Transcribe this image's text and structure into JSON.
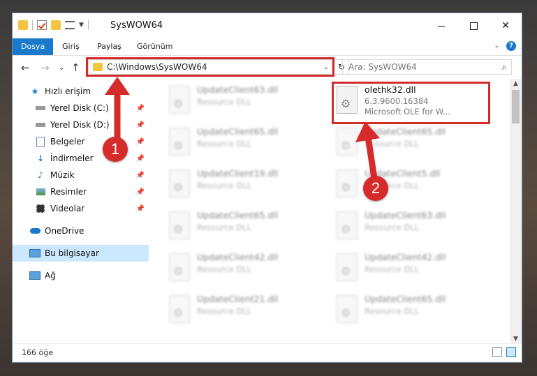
{
  "window": {
    "title": "SysWOW64"
  },
  "ribbon": {
    "tabs": [
      "Dosya",
      "Giriş",
      "Paylaş",
      "Görünüm"
    ],
    "help": "?"
  },
  "navbar": {
    "address": "C:\\Windows\\SysWOW64",
    "search_placeholder": "Ara: SysWOW64"
  },
  "sidebar": {
    "items": [
      {
        "label": "Hızlı erişim",
        "icon": "star-icon"
      },
      {
        "label": "Yerel Disk (C:)",
        "icon": "drive-icon"
      },
      {
        "label": "Yerel Disk (D:)",
        "icon": "drive-icon"
      },
      {
        "label": "Belgeler",
        "icon": "document-icon"
      },
      {
        "label": "İndirmeler",
        "icon": "download-icon"
      },
      {
        "label": "Müzik",
        "icon": "music-icon"
      },
      {
        "label": "Resimler",
        "icon": "pictures-icon"
      },
      {
        "label": "Videolar",
        "icon": "video-icon"
      },
      {
        "label": "OneDrive",
        "icon": "cloud-icon"
      },
      {
        "label": "Bu bilgisayar",
        "icon": "computer-icon"
      },
      {
        "label": "Ağ",
        "icon": "network-icon"
      }
    ]
  },
  "files": [
    {
      "name": "UpdateClient63.dll",
      "type": "Resource DLL"
    },
    {
      "name": "olethk32.dll",
      "version": "6.3.9600.16384",
      "desc": "Microsoft OLE for W..."
    },
    {
      "name": "UpdateClient65.dll",
      "type": "Resource DLL"
    },
    {
      "name": "UpdateClient65.dll",
      "type": "Resource DLL"
    },
    {
      "name": "UpdateClient19.dll",
      "type": "Resource DLL"
    },
    {
      "name": "UpdateClient5.dll",
      "type": "Resource DLL"
    },
    {
      "name": "UpdateClient65.dll",
      "type": "Resource DLL"
    },
    {
      "name": "UpdateClient63.dll",
      "type": "Resource DLL"
    },
    {
      "name": "UpdateClient42.dll",
      "type": "Resource DLL"
    },
    {
      "name": "UpdateClient42.dll",
      "type": "Resource DLL"
    },
    {
      "name": "UpdateClient21.dll",
      "type": "Resource DLL"
    },
    {
      "name": "UpdateClient65.dll",
      "type": "Resource DLL"
    }
  ],
  "status": {
    "count": "166 öğe"
  },
  "annotations": [
    "1",
    "2"
  ],
  "colors": {
    "accent": "#1979ca",
    "highlight": "#d62b2b",
    "selected": "#cce8ff"
  }
}
